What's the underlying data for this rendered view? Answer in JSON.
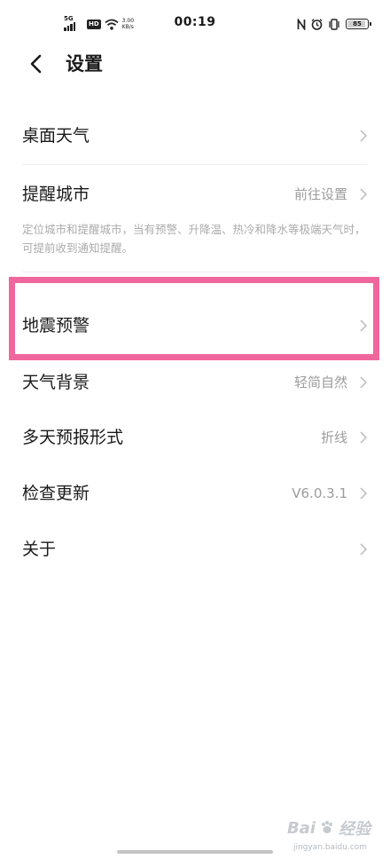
{
  "status_bar": {
    "network": "5G",
    "hd": "HD",
    "speed_value": "3.00",
    "speed_unit": "KB/s",
    "time": "00:19",
    "battery": "85"
  },
  "header": {
    "title": "设置"
  },
  "settings": {
    "desktop_weather": {
      "label": "桌面天气"
    },
    "reminder_city": {
      "label": "提醒城市",
      "value": "前往设置",
      "description": "定位城市和提醒城市，当有预警、升降温、热冷和降水等极端天气时，可提前收到通知提醒。"
    },
    "earthquake_warning": {
      "label": "地震预警"
    },
    "weather_background": {
      "label": "天气背景",
      "value": "轻简自然"
    },
    "multi_day_forecast": {
      "label": "多天预报形式",
      "value": "折线"
    },
    "check_update": {
      "label": "检查更新",
      "value": "V6.0.3.1"
    },
    "about": {
      "label": "关于"
    }
  },
  "watermark": {
    "brand": "Bai",
    "brand_suffix": "经验",
    "sub": "jingyan.baidu.com"
  },
  "colors": {
    "highlight": "#f0679d",
    "secondary_text": "#9c9c9c",
    "chevron": "#c2c2c2"
  }
}
